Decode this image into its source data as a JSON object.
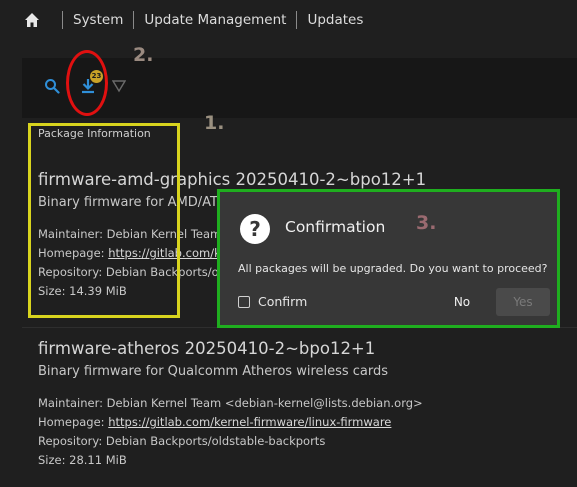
{
  "breadcrumb": {
    "items": [
      "System",
      "Update Management",
      "Updates"
    ]
  },
  "toolbar": {
    "badge_count": "23"
  },
  "annotations": {
    "label_1": "1.",
    "label_2": "2.",
    "label_3": "3."
  },
  "package_list": {
    "section_label": "Package Information",
    "packages": [
      {
        "name": "firmware-amd-graphics 20250410-2~bpo12+1",
        "description": "Binary firmware for AMD/ATI graphics chips",
        "maintainer": "Maintainer: Debian Kernel Team <debian-kernel@lists.debian.org>",
        "homepage_label": "Homepage: ",
        "homepage_url": "https://gitlab.com/kernel-firmware/linux-firmware",
        "repository": "Repository: Debian Backports/oldstable-backports",
        "size": "Size: 14.39 MiB"
      },
      {
        "name": "firmware-atheros 20250410-2~bpo12+1",
        "description": "Binary firmware for Qualcomm Atheros wireless cards",
        "maintainer": "Maintainer: Debian Kernel Team <debian-kernel@lists.debian.org>",
        "homepage_label": "Homepage: ",
        "homepage_url": "https://gitlab.com/kernel-firmware/linux-firmware",
        "repository": "Repository: Debian Backports/oldstable-backports",
        "size": "Size: 28.11 MiB"
      }
    ]
  },
  "dialog": {
    "title": "Confirmation",
    "icon": "?",
    "message": "All packages will be upgraded. Do you want to proceed?",
    "confirm_label": "Confirm",
    "confirm_checked": false,
    "no_label": "No",
    "yes_label": "Yes"
  },
  "colors": {
    "background": "#1f1f1f",
    "accent_blue": "#2f8fd8",
    "badge": "#c9a227",
    "annotation_red": "#e01010",
    "annotation_yellow": "#d8d41e",
    "annotation_green": "#1fae1f",
    "dialog_bg": "#373737"
  },
  "icons": {
    "home": "home-icon",
    "search": "search-icon",
    "download": "download-icon",
    "filter": "filter-icon",
    "question": "question-icon"
  }
}
